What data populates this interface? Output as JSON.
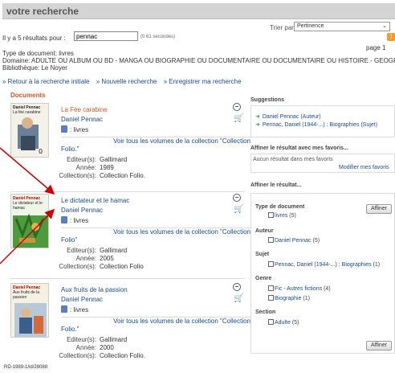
{
  "header": {
    "title": "votre recherche"
  },
  "sort": {
    "label": "Trier par",
    "selected": "Pertinence"
  },
  "results": {
    "prefix": "Il y a 5 résultats pour :",
    "query": "pennac",
    "timing": "(0.61 secondes)",
    "page": "page 1"
  },
  "filters": {
    "doc_type": "Type de document: livres",
    "domain": "Domaine: ADULTE OU ALBUM OU BD - MANGA OU BIOGRAPHIE OU DOCUMENTAIRE OU DOCUMENTAIRE OU HISTOIRE - GEOGRAPHIE",
    "library": "Bibliothèque: Le Noyer"
  },
  "actions": [
    "» Retour à la recherche initiale",
    "» Nouvelle recherche",
    "» Enregistrer ma recherche"
  ],
  "documents_heading": "Documents",
  "records": [
    {
      "title": "La Fée carabine",
      "author": "Daniel Pennac",
      "type": ": livres",
      "collection_link": "Voir tous les volumes de la collection \"Collection",
      "collection_link_end": "Folio.\"",
      "cover_author": "Daniel Pennac",
      "cover_title": "La fée carabine",
      "editeur_label": "Editeur(s):",
      "editeur": "Gallimard",
      "annee_label": "Année:",
      "annee": "1989",
      "collection_label": "Collection(s):",
      "collection": "Collection Folio."
    },
    {
      "title": "Le dictateur et le hamac",
      "author": "Daniel Pennac",
      "type": ": livres",
      "collection_link": "Voir tous les volumes de la collection \"Collection",
      "collection_link_end": "Folio\"",
      "cover_author": "Daniel Pennac",
      "cover_title": "Le dictateur et le hamac",
      "editeur_label": "Editeur(s):",
      "editeur": "Gallimard",
      "annee_label": "Année:",
      "annee": "2005",
      "collection_label": "Collection(s):",
      "collection": "Collection Folio"
    },
    {
      "title": "Aux fruits de la passion",
      "author": "Daniel Pennac",
      "type": ": livres",
      "collection_link": "Voir tous les volumes de la collection \"Collection",
      "collection_link_end": "Folio.\"",
      "cover_author": "Daniel Pennac",
      "cover_title": "Aux fruits de la passion",
      "editeur_label": "Editeur(s):",
      "editeur": "Gallimard",
      "annee_label": "Année:",
      "annee": "2000",
      "collection_label": "Collection(s):",
      "collection": "Collection Folio."
    }
  ],
  "call_number": "RD-1989-1/id/28088",
  "suggestions": {
    "title": "Suggestions",
    "items": [
      "Daniel Pennac (Auteur)",
      "Pennac, Daniel (1944-...) : Biographies (Sujet)"
    ]
  },
  "favorites": {
    "title": "Affiner le résultat avec mes favoris...",
    "empty": "Aucun résultat dans mes favoris",
    "manage": "Modifier mes favoris"
  },
  "refine": {
    "title": "Affiner le résultat...",
    "button": "Affiner",
    "facets": [
      {
        "heading": "Type de document",
        "items": [
          {
            "label": "livres",
            "count": "(5)"
          }
        ]
      },
      {
        "heading": "Auteur",
        "items": [
          {
            "label": "Daniel Pennac",
            "count": "(5)"
          }
        ]
      },
      {
        "heading": "Sujet",
        "items": [
          {
            "label": "Pennac, Daniel (1944-...) : Biographies",
            "count": "(1)"
          }
        ]
      },
      {
        "heading": "Genre",
        "items": [
          {
            "label": "Fic - Autres fictions",
            "count": "(4)"
          },
          {
            "label": "Biographie",
            "count": "(1)"
          }
        ]
      },
      {
        "heading": "Section",
        "items": [
          {
            "label": "Adulte",
            "count": "(5)"
          }
        ]
      }
    ]
  },
  "colors": {
    "accent_link": "#1a4a8c",
    "title_orange": "#d9541e",
    "annotation_red": "#cc0000"
  }
}
